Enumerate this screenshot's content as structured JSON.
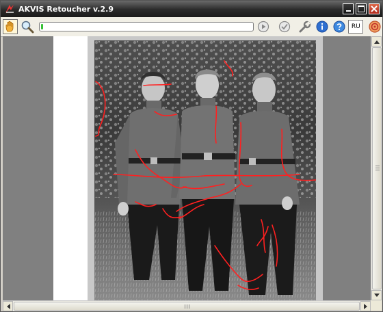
{
  "window": {
    "title": "AKVIS Retoucher v.2.9",
    "controls": [
      "minimize",
      "maximize",
      "close"
    ]
  },
  "toolbar": {
    "tools": [
      {
        "name": "hand-tool",
        "icon": "hand-icon",
        "active": true
      },
      {
        "name": "zoom-tool",
        "icon": "magnifier-icon",
        "active": false
      }
    ],
    "progress": 0.01,
    "actions": [
      {
        "name": "run-button",
        "icon": "play-circle-icon"
      },
      {
        "name": "apply-button",
        "icon": "checkmark-circle-icon"
      },
      {
        "name": "settings-button",
        "icon": "wrench-icon"
      },
      {
        "name": "info-button",
        "icon": "info-icon"
      },
      {
        "name": "help-button",
        "icon": "help-icon"
      }
    ],
    "language": "RU",
    "extra_icon": "akvis-spiral-icon"
  },
  "colors": {
    "titlebar": "#2b2b2b",
    "close_button": "#c43a22",
    "workspace": "#808080",
    "mask_strokes": "#ff2020",
    "progress_fill": "#35c135"
  },
  "image": {
    "description_icon": "photo-three-soldiers"
  }
}
